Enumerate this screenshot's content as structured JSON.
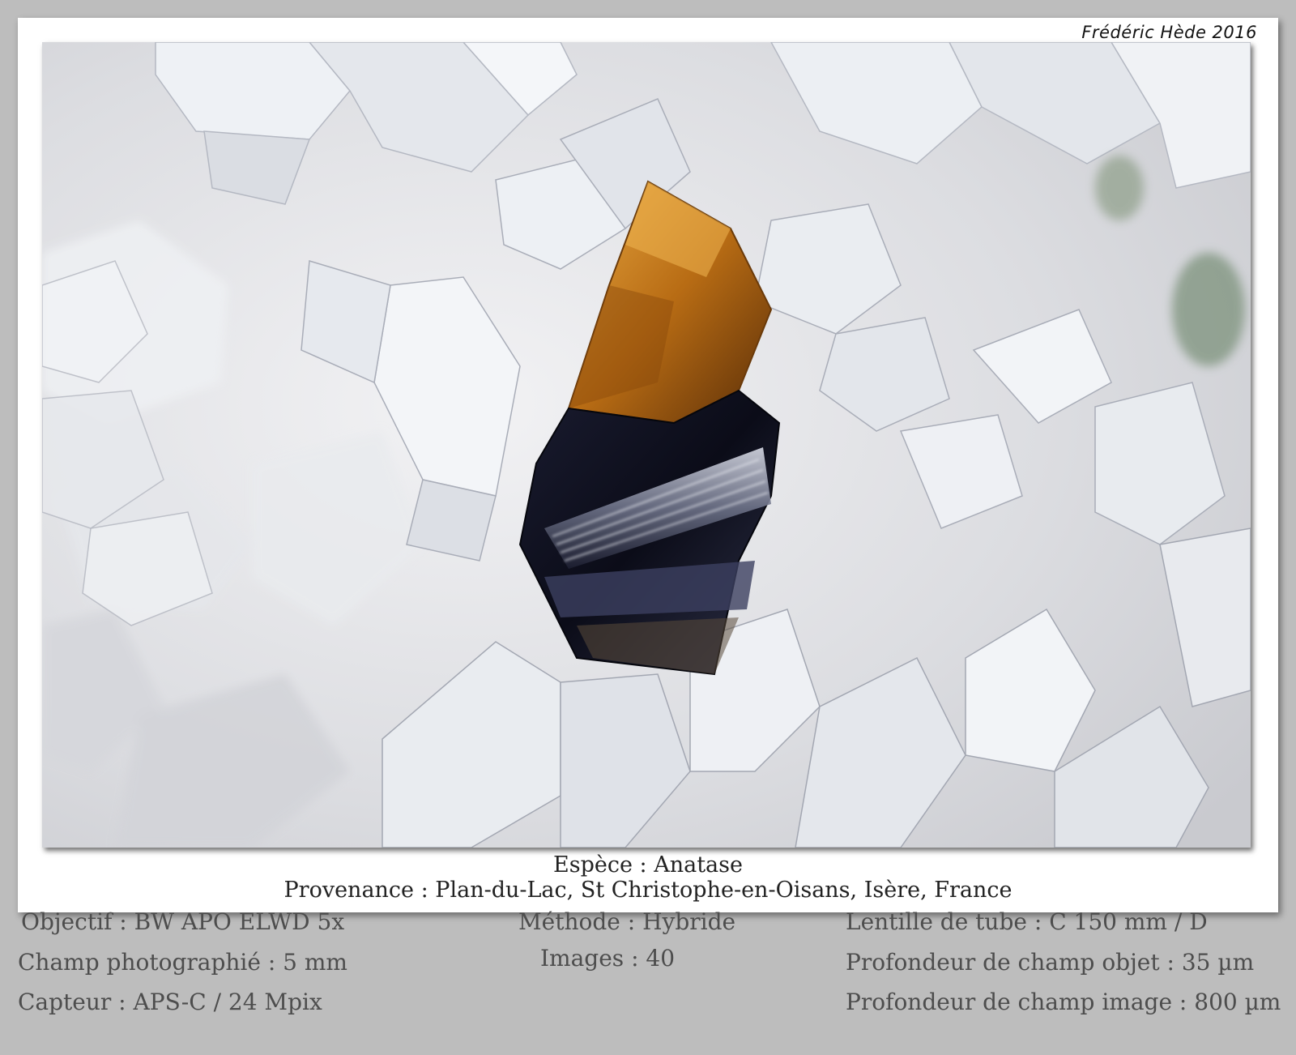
{
  "credit": "Frédéric Hède 2016",
  "caption": {
    "species": "Espèce : Anatase",
    "origin": "Provenance : Plan-du-Lac, St Christophe-en-Oisans, Isère, France"
  },
  "details": {
    "left": [
      "Objectif : BW APO ELWD 5x",
      "Champ photographié : 5 mm",
      "Capteur : APS-C / 24 Mpix"
    ],
    "center": [
      "Méthode : Hybride",
      "Images : 40"
    ],
    "right": [
      "Lentille de tube : C 150 mm / D",
      "Profondeur de champ objet : 35 µm",
      "Profondeur de champ image : 800 µm"
    ]
  },
  "colors": {
    "page_background": "#bdbdbd",
    "frame": "#ffffff",
    "quartz": "#e8eaee",
    "anatase_amber": "#c07a1c",
    "anatase_dark": "#14162a"
  }
}
